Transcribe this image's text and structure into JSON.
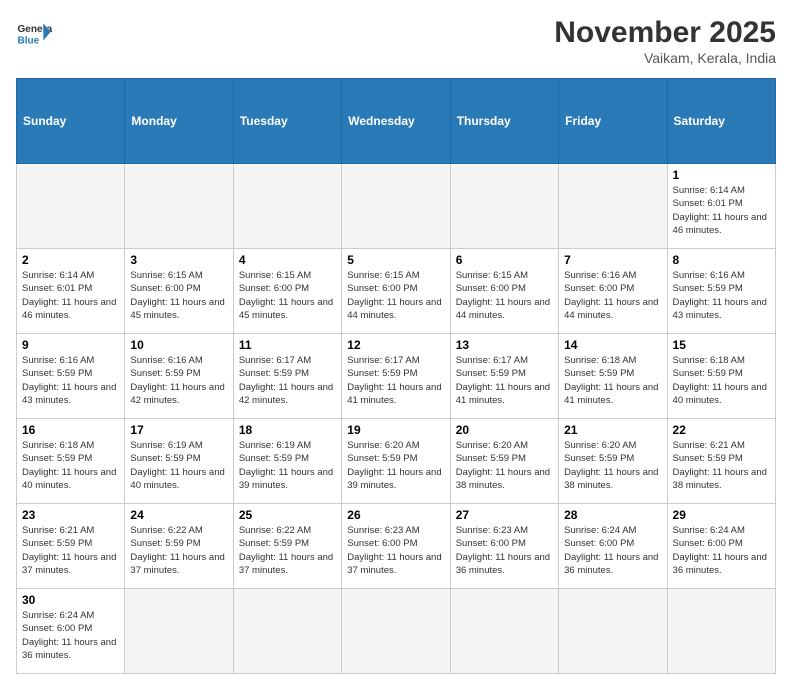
{
  "header": {
    "logo_general": "General",
    "logo_blue": "Blue",
    "month_title": "November 2025",
    "subtitle": "Vaikam, Kerala, India"
  },
  "days_of_week": [
    "Sunday",
    "Monday",
    "Tuesday",
    "Wednesday",
    "Thursday",
    "Friday",
    "Saturday"
  ],
  "weeks": [
    [
      {
        "day": "",
        "empty": true
      },
      {
        "day": "",
        "empty": true
      },
      {
        "day": "",
        "empty": true
      },
      {
        "day": "",
        "empty": true
      },
      {
        "day": "",
        "empty": true
      },
      {
        "day": "",
        "empty": true
      },
      {
        "day": "1",
        "sunrise": "6:14 AM",
        "sunset": "6:01 PM",
        "daylight": "11 hours and 46 minutes."
      }
    ],
    [
      {
        "day": "2",
        "sunrise": "6:14 AM",
        "sunset": "6:01 PM",
        "daylight": "11 hours and 46 minutes."
      },
      {
        "day": "3",
        "sunrise": "6:15 AM",
        "sunset": "6:00 PM",
        "daylight": "11 hours and 45 minutes."
      },
      {
        "day": "4",
        "sunrise": "6:15 AM",
        "sunset": "6:00 PM",
        "daylight": "11 hours and 45 minutes."
      },
      {
        "day": "5",
        "sunrise": "6:15 AM",
        "sunset": "6:00 PM",
        "daylight": "11 hours and 44 minutes."
      },
      {
        "day": "6",
        "sunrise": "6:15 AM",
        "sunset": "6:00 PM",
        "daylight": "11 hours and 44 minutes."
      },
      {
        "day": "7",
        "sunrise": "6:16 AM",
        "sunset": "6:00 PM",
        "daylight": "11 hours and 44 minutes."
      },
      {
        "day": "8",
        "sunrise": "6:16 AM",
        "sunset": "5:59 PM",
        "daylight": "11 hours and 43 minutes."
      }
    ],
    [
      {
        "day": "9",
        "sunrise": "6:16 AM",
        "sunset": "5:59 PM",
        "daylight": "11 hours and 43 minutes."
      },
      {
        "day": "10",
        "sunrise": "6:16 AM",
        "sunset": "5:59 PM",
        "daylight": "11 hours and 42 minutes."
      },
      {
        "day": "11",
        "sunrise": "6:17 AM",
        "sunset": "5:59 PM",
        "daylight": "11 hours and 42 minutes."
      },
      {
        "day": "12",
        "sunrise": "6:17 AM",
        "sunset": "5:59 PM",
        "daylight": "11 hours and 41 minutes."
      },
      {
        "day": "13",
        "sunrise": "6:17 AM",
        "sunset": "5:59 PM",
        "daylight": "11 hours and 41 minutes."
      },
      {
        "day": "14",
        "sunrise": "6:18 AM",
        "sunset": "5:59 PM",
        "daylight": "11 hours and 41 minutes."
      },
      {
        "day": "15",
        "sunrise": "6:18 AM",
        "sunset": "5:59 PM",
        "daylight": "11 hours and 40 minutes."
      }
    ],
    [
      {
        "day": "16",
        "sunrise": "6:18 AM",
        "sunset": "5:59 PM",
        "daylight": "11 hours and 40 minutes."
      },
      {
        "day": "17",
        "sunrise": "6:19 AM",
        "sunset": "5:59 PM",
        "daylight": "11 hours and 40 minutes."
      },
      {
        "day": "18",
        "sunrise": "6:19 AM",
        "sunset": "5:59 PM",
        "daylight": "11 hours and 39 minutes."
      },
      {
        "day": "19",
        "sunrise": "6:20 AM",
        "sunset": "5:59 PM",
        "daylight": "11 hours and 39 minutes."
      },
      {
        "day": "20",
        "sunrise": "6:20 AM",
        "sunset": "5:59 PM",
        "daylight": "11 hours and 38 minutes."
      },
      {
        "day": "21",
        "sunrise": "6:20 AM",
        "sunset": "5:59 PM",
        "daylight": "11 hours and 38 minutes."
      },
      {
        "day": "22",
        "sunrise": "6:21 AM",
        "sunset": "5:59 PM",
        "daylight": "11 hours and 38 minutes."
      }
    ],
    [
      {
        "day": "23",
        "sunrise": "6:21 AM",
        "sunset": "5:59 PM",
        "daylight": "11 hours and 37 minutes."
      },
      {
        "day": "24",
        "sunrise": "6:22 AM",
        "sunset": "5:59 PM",
        "daylight": "11 hours and 37 minutes."
      },
      {
        "day": "25",
        "sunrise": "6:22 AM",
        "sunset": "5:59 PM",
        "daylight": "11 hours and 37 minutes."
      },
      {
        "day": "26",
        "sunrise": "6:23 AM",
        "sunset": "6:00 PM",
        "daylight": "11 hours and 37 minutes."
      },
      {
        "day": "27",
        "sunrise": "6:23 AM",
        "sunset": "6:00 PM",
        "daylight": "11 hours and 36 minutes."
      },
      {
        "day": "28",
        "sunrise": "6:24 AM",
        "sunset": "6:00 PM",
        "daylight": "11 hours and 36 minutes."
      },
      {
        "day": "29",
        "sunrise": "6:24 AM",
        "sunset": "6:00 PM",
        "daylight": "11 hours and 36 minutes."
      }
    ],
    [
      {
        "day": "30",
        "sunrise": "6:24 AM",
        "sunset": "6:00 PM",
        "daylight": "11 hours and 36 minutes."
      },
      {
        "day": "",
        "empty": true
      },
      {
        "day": "",
        "empty": true
      },
      {
        "day": "",
        "empty": true
      },
      {
        "day": "",
        "empty": true
      },
      {
        "day": "",
        "empty": true
      },
      {
        "day": "",
        "empty": true
      }
    ]
  ],
  "labels": {
    "sunrise": "Sunrise:",
    "sunset": "Sunset:",
    "daylight": "Daylight:"
  }
}
